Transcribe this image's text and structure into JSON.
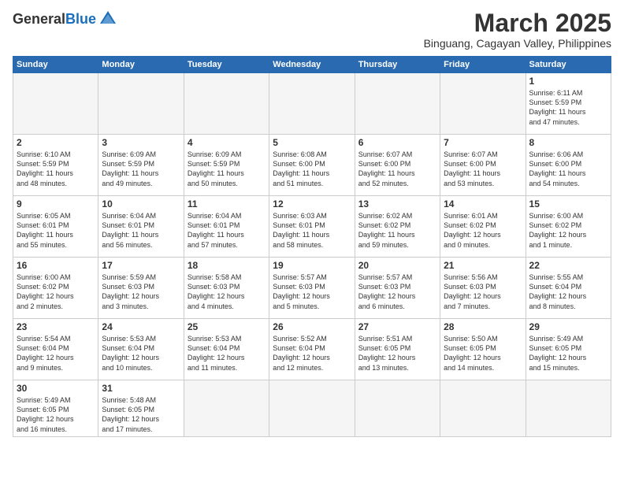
{
  "header": {
    "logo_general": "General",
    "logo_blue": "Blue",
    "month_title": "March 2025",
    "subtitle": "Binguang, Cagayan Valley, Philippines"
  },
  "weekdays": [
    "Sunday",
    "Monday",
    "Tuesday",
    "Wednesday",
    "Thursday",
    "Friday",
    "Saturday"
  ],
  "weeks": [
    [
      {
        "day": "",
        "info": ""
      },
      {
        "day": "",
        "info": ""
      },
      {
        "day": "",
        "info": ""
      },
      {
        "day": "",
        "info": ""
      },
      {
        "day": "",
        "info": ""
      },
      {
        "day": "",
        "info": ""
      },
      {
        "day": "1",
        "info": "Sunrise: 6:11 AM\nSunset: 5:59 PM\nDaylight: 11 hours\nand 47 minutes."
      }
    ],
    [
      {
        "day": "2",
        "info": "Sunrise: 6:10 AM\nSunset: 5:59 PM\nDaylight: 11 hours\nand 48 minutes."
      },
      {
        "day": "3",
        "info": "Sunrise: 6:09 AM\nSunset: 5:59 PM\nDaylight: 11 hours\nand 49 minutes."
      },
      {
        "day": "4",
        "info": "Sunrise: 6:09 AM\nSunset: 5:59 PM\nDaylight: 11 hours\nand 50 minutes."
      },
      {
        "day": "5",
        "info": "Sunrise: 6:08 AM\nSunset: 6:00 PM\nDaylight: 11 hours\nand 51 minutes."
      },
      {
        "day": "6",
        "info": "Sunrise: 6:07 AM\nSunset: 6:00 PM\nDaylight: 11 hours\nand 52 minutes."
      },
      {
        "day": "7",
        "info": "Sunrise: 6:07 AM\nSunset: 6:00 PM\nDaylight: 11 hours\nand 53 minutes."
      },
      {
        "day": "8",
        "info": "Sunrise: 6:06 AM\nSunset: 6:00 PM\nDaylight: 11 hours\nand 54 minutes."
      }
    ],
    [
      {
        "day": "9",
        "info": "Sunrise: 6:05 AM\nSunset: 6:01 PM\nDaylight: 11 hours\nand 55 minutes."
      },
      {
        "day": "10",
        "info": "Sunrise: 6:04 AM\nSunset: 6:01 PM\nDaylight: 11 hours\nand 56 minutes."
      },
      {
        "day": "11",
        "info": "Sunrise: 6:04 AM\nSunset: 6:01 PM\nDaylight: 11 hours\nand 57 minutes."
      },
      {
        "day": "12",
        "info": "Sunrise: 6:03 AM\nSunset: 6:01 PM\nDaylight: 11 hours\nand 58 minutes."
      },
      {
        "day": "13",
        "info": "Sunrise: 6:02 AM\nSunset: 6:02 PM\nDaylight: 11 hours\nand 59 minutes."
      },
      {
        "day": "14",
        "info": "Sunrise: 6:01 AM\nSunset: 6:02 PM\nDaylight: 12 hours\nand 0 minutes."
      },
      {
        "day": "15",
        "info": "Sunrise: 6:00 AM\nSunset: 6:02 PM\nDaylight: 12 hours\nand 1 minute."
      }
    ],
    [
      {
        "day": "16",
        "info": "Sunrise: 6:00 AM\nSunset: 6:02 PM\nDaylight: 12 hours\nand 2 minutes."
      },
      {
        "day": "17",
        "info": "Sunrise: 5:59 AM\nSunset: 6:03 PM\nDaylight: 12 hours\nand 3 minutes."
      },
      {
        "day": "18",
        "info": "Sunrise: 5:58 AM\nSunset: 6:03 PM\nDaylight: 12 hours\nand 4 minutes."
      },
      {
        "day": "19",
        "info": "Sunrise: 5:57 AM\nSunset: 6:03 PM\nDaylight: 12 hours\nand 5 minutes."
      },
      {
        "day": "20",
        "info": "Sunrise: 5:57 AM\nSunset: 6:03 PM\nDaylight: 12 hours\nand 6 minutes."
      },
      {
        "day": "21",
        "info": "Sunrise: 5:56 AM\nSunset: 6:03 PM\nDaylight: 12 hours\nand 7 minutes."
      },
      {
        "day": "22",
        "info": "Sunrise: 5:55 AM\nSunset: 6:04 PM\nDaylight: 12 hours\nand 8 minutes."
      }
    ],
    [
      {
        "day": "23",
        "info": "Sunrise: 5:54 AM\nSunset: 6:04 PM\nDaylight: 12 hours\nand 9 minutes."
      },
      {
        "day": "24",
        "info": "Sunrise: 5:53 AM\nSunset: 6:04 PM\nDaylight: 12 hours\nand 10 minutes."
      },
      {
        "day": "25",
        "info": "Sunrise: 5:53 AM\nSunset: 6:04 PM\nDaylight: 12 hours\nand 11 minutes."
      },
      {
        "day": "26",
        "info": "Sunrise: 5:52 AM\nSunset: 6:04 PM\nDaylight: 12 hours\nand 12 minutes."
      },
      {
        "day": "27",
        "info": "Sunrise: 5:51 AM\nSunset: 6:05 PM\nDaylight: 12 hours\nand 13 minutes."
      },
      {
        "day": "28",
        "info": "Sunrise: 5:50 AM\nSunset: 6:05 PM\nDaylight: 12 hours\nand 14 minutes."
      },
      {
        "day": "29",
        "info": "Sunrise: 5:49 AM\nSunset: 6:05 PM\nDaylight: 12 hours\nand 15 minutes."
      }
    ],
    [
      {
        "day": "30",
        "info": "Sunrise: 5:49 AM\nSunset: 6:05 PM\nDaylight: 12 hours\nand 16 minutes."
      },
      {
        "day": "31",
        "info": "Sunrise: 5:48 AM\nSunset: 6:05 PM\nDaylight: 12 hours\nand 17 minutes."
      },
      {
        "day": "",
        "info": ""
      },
      {
        "day": "",
        "info": ""
      },
      {
        "day": "",
        "info": ""
      },
      {
        "day": "",
        "info": ""
      },
      {
        "day": "",
        "info": ""
      }
    ]
  ]
}
